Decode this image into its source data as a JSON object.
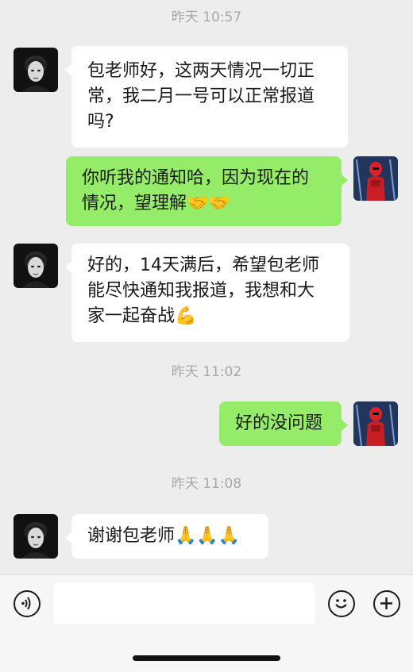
{
  "colors": {
    "background": "#ededed",
    "bubble_incoming": "#ffffff",
    "bubble_outgoing": "#95ec69",
    "timestamp_text": "#a8a8a8"
  },
  "messages": [
    {
      "type": "timestamp",
      "text": "昨天 10:57"
    },
    {
      "type": "incoming",
      "sender_icon": "avatar-portrait-bw",
      "lines": [
        "包老师好，这两天情况一切正",
        "常，我二月一号可以正常报道",
        "吗?"
      ]
    },
    {
      "type": "outgoing",
      "sender_icon": "avatar-red-trooper",
      "lines": [
        "你听我的通知哈，因为现在的",
        "情况，望理解"
      ],
      "emoji": "🤝🤝"
    },
    {
      "type": "incoming",
      "sender_icon": "avatar-portrait-bw",
      "lines": [
        "好的，14天满后，希望包老师",
        "能尽快通知我报道，我想和大",
        "家一起奋战"
      ],
      "emoji": "💪"
    },
    {
      "type": "timestamp",
      "text": "昨天 11:02"
    },
    {
      "type": "outgoing",
      "sender_icon": "avatar-red-trooper",
      "lines": [
        "好的没问题"
      ]
    },
    {
      "type": "timestamp",
      "text": "昨天 11:08"
    },
    {
      "type": "incoming",
      "sender_icon": "avatar-portrait-bw",
      "lines": [
        "谢谢包老师"
      ],
      "emoji": "🙏🙏🙏"
    }
  ],
  "input_bar": {
    "voice_icon": "voice-icon",
    "text_value": "",
    "emoji_icon": "smiley-icon",
    "more_icon": "plus-icon"
  }
}
